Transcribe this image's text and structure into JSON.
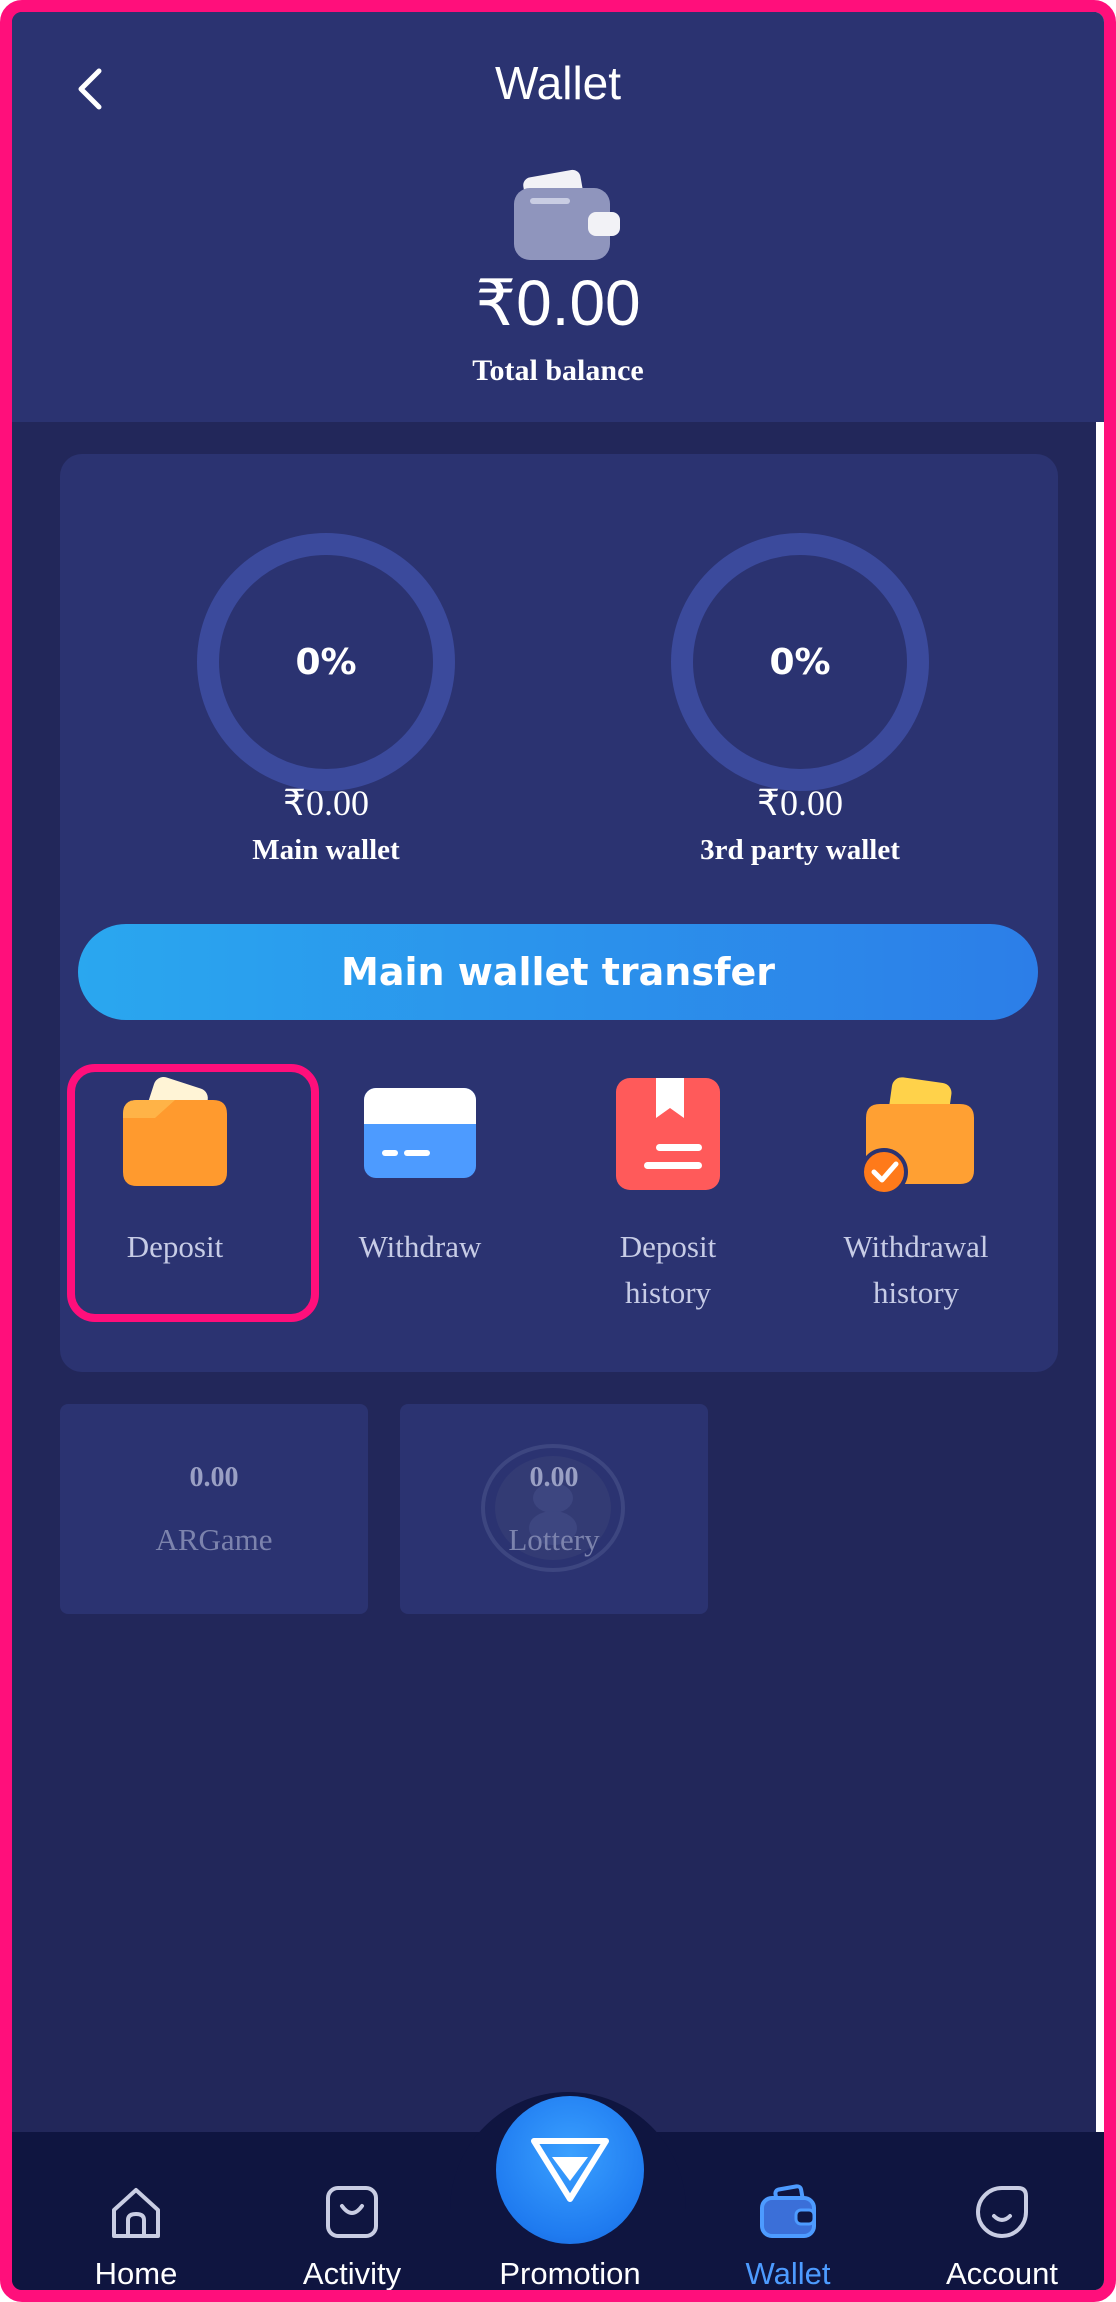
{
  "header": {
    "title": "Wallet",
    "total_balance": "₹0.00",
    "total_label": "Total balance"
  },
  "wallets": [
    {
      "percent_text": "0%",
      "percent": 0,
      "amount": "₹0.00",
      "label": "Main wallet"
    },
    {
      "percent_text": "0%",
      "percent": 0,
      "amount": "₹0.00",
      "label": "3rd party wallet"
    }
  ],
  "transfer_button": "Main wallet transfer",
  "actions": [
    {
      "label": "Deposit",
      "icon": "deposit-wallet-icon"
    },
    {
      "label": "Withdraw",
      "icon": "card-icon"
    },
    {
      "label": "Deposit\nhistory",
      "icon": "bookmark-document-icon"
    },
    {
      "label": "Withdrawal\nhistory",
      "icon": "wallet-check-icon"
    }
  ],
  "games": [
    {
      "value": "0.00",
      "name": "ARGame"
    },
    {
      "value": "0.00",
      "name": "Lottery"
    }
  ],
  "nav": [
    {
      "label": "Home",
      "icon": "home-icon"
    },
    {
      "label": "Activity",
      "icon": "shopping-bag-icon"
    },
    {
      "label": "Promotion",
      "icon": "diamond-icon"
    },
    {
      "label": "Wallet",
      "icon": "wallet-icon",
      "active": true
    },
    {
      "label": "Account",
      "icon": "account-icon"
    }
  ],
  "colors": {
    "background": "#22275a",
    "card": "#2b3371",
    "accent": "#2aa7ef",
    "active_nav": "#4d9bff",
    "highlight": "#ff0f7b"
  }
}
